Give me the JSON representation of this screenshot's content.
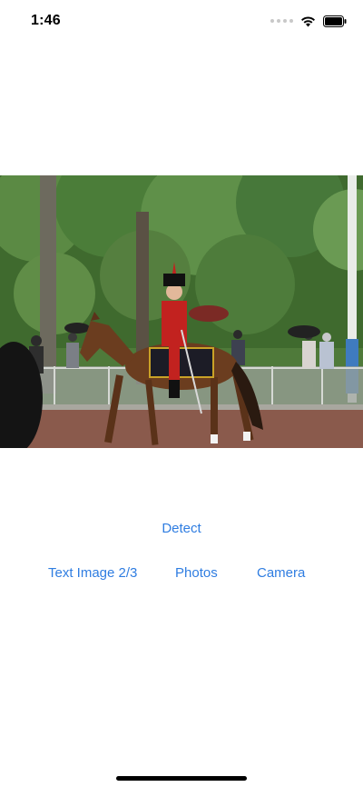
{
  "status_bar": {
    "time": "1:46",
    "icons": [
      "signal-icon",
      "wifi-icon",
      "battery-icon"
    ]
  },
  "photo": {
    "subject": "photo"
  },
  "buttons": {
    "detect": "Detect",
    "text_image": "Text Image 2/3",
    "photos": "Photos",
    "camera": "Camera"
  },
  "colors": {
    "accent": "#2f7de1",
    "background": "#ffffff"
  }
}
